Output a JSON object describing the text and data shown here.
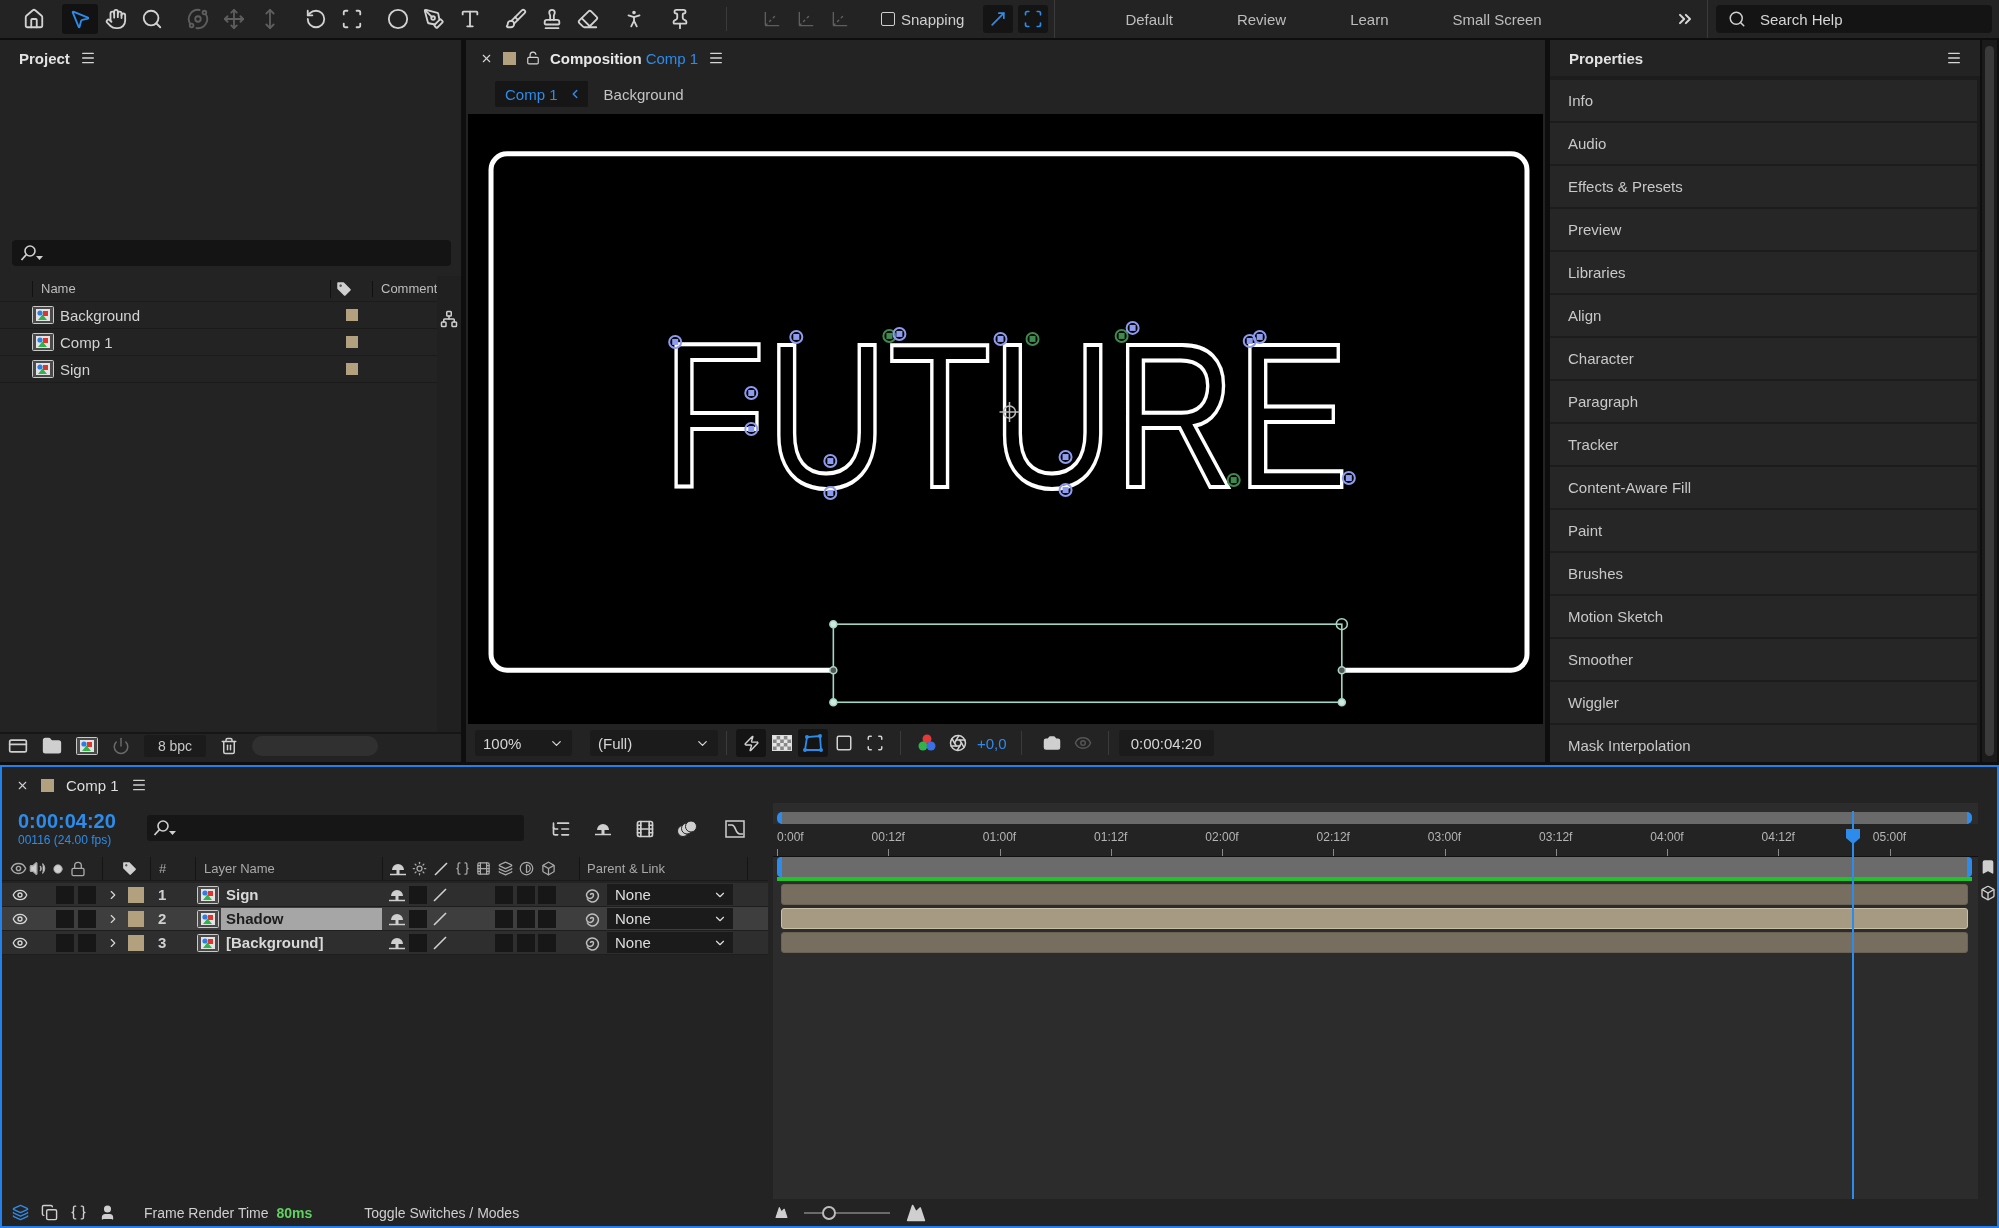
{
  "toolbar": {
    "tools": [
      {
        "selected": false,
        "disabled": false
      },
      {
        "selected": true,
        "disabled": false
      },
      {
        "selected": false,
        "disabled": false
      },
      {
        "selected": false,
        "disabled": false
      },
      {
        "selected": false,
        "disabled": true
      },
      {
        "selected": false,
        "disabled": true
      },
      {
        "selected": false,
        "disabled": true
      },
      {
        "selected": false,
        "disabled": false
      },
      {
        "selected": false,
        "disabled": false
      },
      {
        "selected": false,
        "disabled": false
      },
      {
        "selected": false,
        "disabled": false
      },
      {
        "selected": false,
        "disabled": false
      },
      {
        "selected": false,
        "disabled": false
      },
      {
        "selected": false,
        "disabled": false
      },
      {
        "selected": false,
        "disabled": false
      },
      {
        "selected": false,
        "disabled": false
      },
      {
        "selected": false,
        "disabled": false
      }
    ],
    "axis_modes": [
      {
        "disabled": true
      },
      {
        "disabled": true
      },
      {
        "disabled": true
      }
    ],
    "snapping": {
      "label": "Snapping",
      "checked": false
    },
    "snap_options": [
      {
        "on": true
      },
      {
        "on": true
      }
    ],
    "workspaces": [
      {
        "label": "Default",
        "selected": false
      },
      {
        "label": "Review",
        "selected": false
      },
      {
        "label": "Learn",
        "selected": false
      },
      {
        "label": "Small Screen",
        "selected": false
      }
    ],
    "search": {
      "placeholder": "Search Help"
    }
  },
  "project": {
    "title": "Project",
    "columns": [
      "Name",
      "Comment"
    ],
    "items": [
      {
        "name": "Background"
      },
      {
        "name": "Comp 1"
      },
      {
        "name": "Sign"
      }
    ],
    "bit_depth": "8 bpc"
  },
  "composition": {
    "title": "Composition",
    "comp_name": "Comp 1",
    "breadcrumbs": [
      {
        "label": "Comp 1",
        "selected": true
      },
      {
        "label": "Background",
        "selected": false
      }
    ],
    "artwork_text": "FUTURE",
    "zoom": "100%",
    "resolution": "(Full)",
    "exposure": "+0,0",
    "timecode": "0:00:04:20"
  },
  "properties": {
    "title": "Properties",
    "sections": [
      "Info",
      "Audio",
      "Effects & Presets",
      "Preview",
      "Libraries",
      "Align",
      "Character",
      "Paragraph",
      "Tracker",
      "Content-Aware Fill",
      "Paint",
      "Brushes",
      "Motion Sketch",
      "Smoother",
      "Wiggler",
      "Mask Interpolation"
    ]
  },
  "timeline": {
    "title": "Comp 1",
    "timecode": "0:00:04:20",
    "frame_info": "00116 (24.00 fps)",
    "columns": {
      "number": "#",
      "layer_name": "Layer Name",
      "parent": "Parent & Link"
    },
    "layers": [
      {
        "number": "1",
        "name": "Sign",
        "visible": true,
        "selected": false,
        "parent": "None"
      },
      {
        "number": "2",
        "name": "Shadow",
        "visible": true,
        "selected": true,
        "parent": "None"
      },
      {
        "number": "3",
        "name": "[Background]",
        "visible": true,
        "selected": false,
        "parent": "None"
      }
    ],
    "ruler": [
      "0:00f",
      "00:12f",
      "01:00f",
      "01:12f",
      "02:00f",
      "02:12f",
      "03:00f",
      "03:12f",
      "04:00f",
      "04:12f",
      "05:00f"
    ],
    "playhead": {
      "level": 0.9
    }
  },
  "status_bar": {
    "render_label": "Frame Render Time",
    "render_time": "80ms",
    "toggle": "Toggle Switches / Modes",
    "zoom_slider": {
      "level": 0.25
    }
  }
}
